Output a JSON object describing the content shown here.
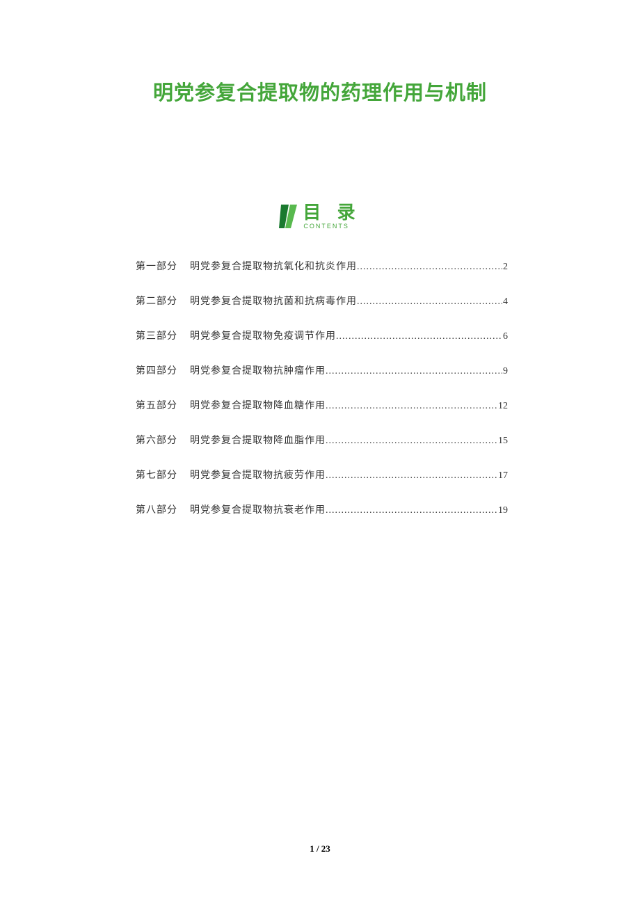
{
  "title": "明党参复合提取物的药理作用与机制",
  "toc": {
    "heading": "目 录",
    "subheading": "CONTENTS",
    "items": [
      {
        "part": "第一部分",
        "entry": "明党参复合提取物抗氧化和抗炎作用",
        "page": "2"
      },
      {
        "part": "第二部分",
        "entry": "明党参复合提取物抗菌和抗病毒作用",
        "page": "4"
      },
      {
        "part": "第三部分",
        "entry": "明党参复合提取物免疫调节作用",
        "page": "6"
      },
      {
        "part": "第四部分",
        "entry": "明党参复合提取物抗肿瘤作用",
        "page": "9"
      },
      {
        "part": "第五部分",
        "entry": "明党参复合提取物降血糖作用",
        "page": "12"
      },
      {
        "part": "第六部分",
        "entry": "明党参复合提取物降血脂作用",
        "page": "15"
      },
      {
        "part": "第七部分",
        "entry": "明党参复合提取物抗疲劳作用",
        "page": "17"
      },
      {
        "part": "第八部分",
        "entry": "明党参复合提取物抗衰老作用",
        "page": "19"
      }
    ]
  },
  "footer": "1 / 23"
}
